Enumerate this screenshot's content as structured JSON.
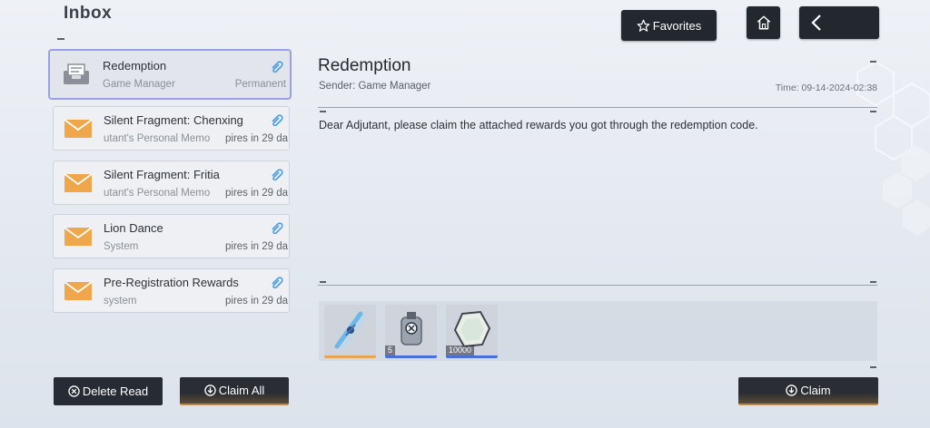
{
  "header": {
    "title": "Inbox",
    "favorites_label": "Favorites"
  },
  "mails": [
    {
      "title": "Redemption",
      "sender": "Game Manager",
      "expiry": "Permanent",
      "selected": true
    },
    {
      "title": "Silent Fragment: Chenxing",
      "sender": "utant's Personal Memo",
      "expiry": "pires in 29 da",
      "selected": false
    },
    {
      "title": "Silent Fragment: Fritia",
      "sender": "utant's Personal Memo",
      "expiry": "pires in 29 da",
      "selected": false
    },
    {
      "title": "Lion Dance",
      "sender": "System",
      "expiry": "pires in 29 da",
      "selected": false
    },
    {
      "title": "Pre-Registration Rewards",
      "sender": "system",
      "expiry": "pires in 29 da",
      "selected": false
    }
  ],
  "detail": {
    "title": "Redemption",
    "sender_label": "Sender:",
    "sender": "Game Manager",
    "time_label": "Time:",
    "time": "09-14-2024-02:38",
    "body": "Dear Adjutant, please claim the attached rewards you got through the redemption code."
  },
  "rewards": [
    {
      "icon": "tuning-fork-item-icon",
      "quantity": ""
    },
    {
      "icon": "canister-item-icon",
      "quantity": "5"
    },
    {
      "icon": "hexagon-crystal-item-icon",
      "quantity": "10000"
    }
  ],
  "actions": {
    "delete_read": "Delete Read",
    "claim_all": "Claim All",
    "claim": "Claim"
  },
  "colors": {
    "accent_orange": "#f0a64a",
    "selection": "#9aa0e8",
    "dark_button": "#23272e",
    "gold_trim": "#b9894b",
    "link_blue": "#4d9de0"
  }
}
